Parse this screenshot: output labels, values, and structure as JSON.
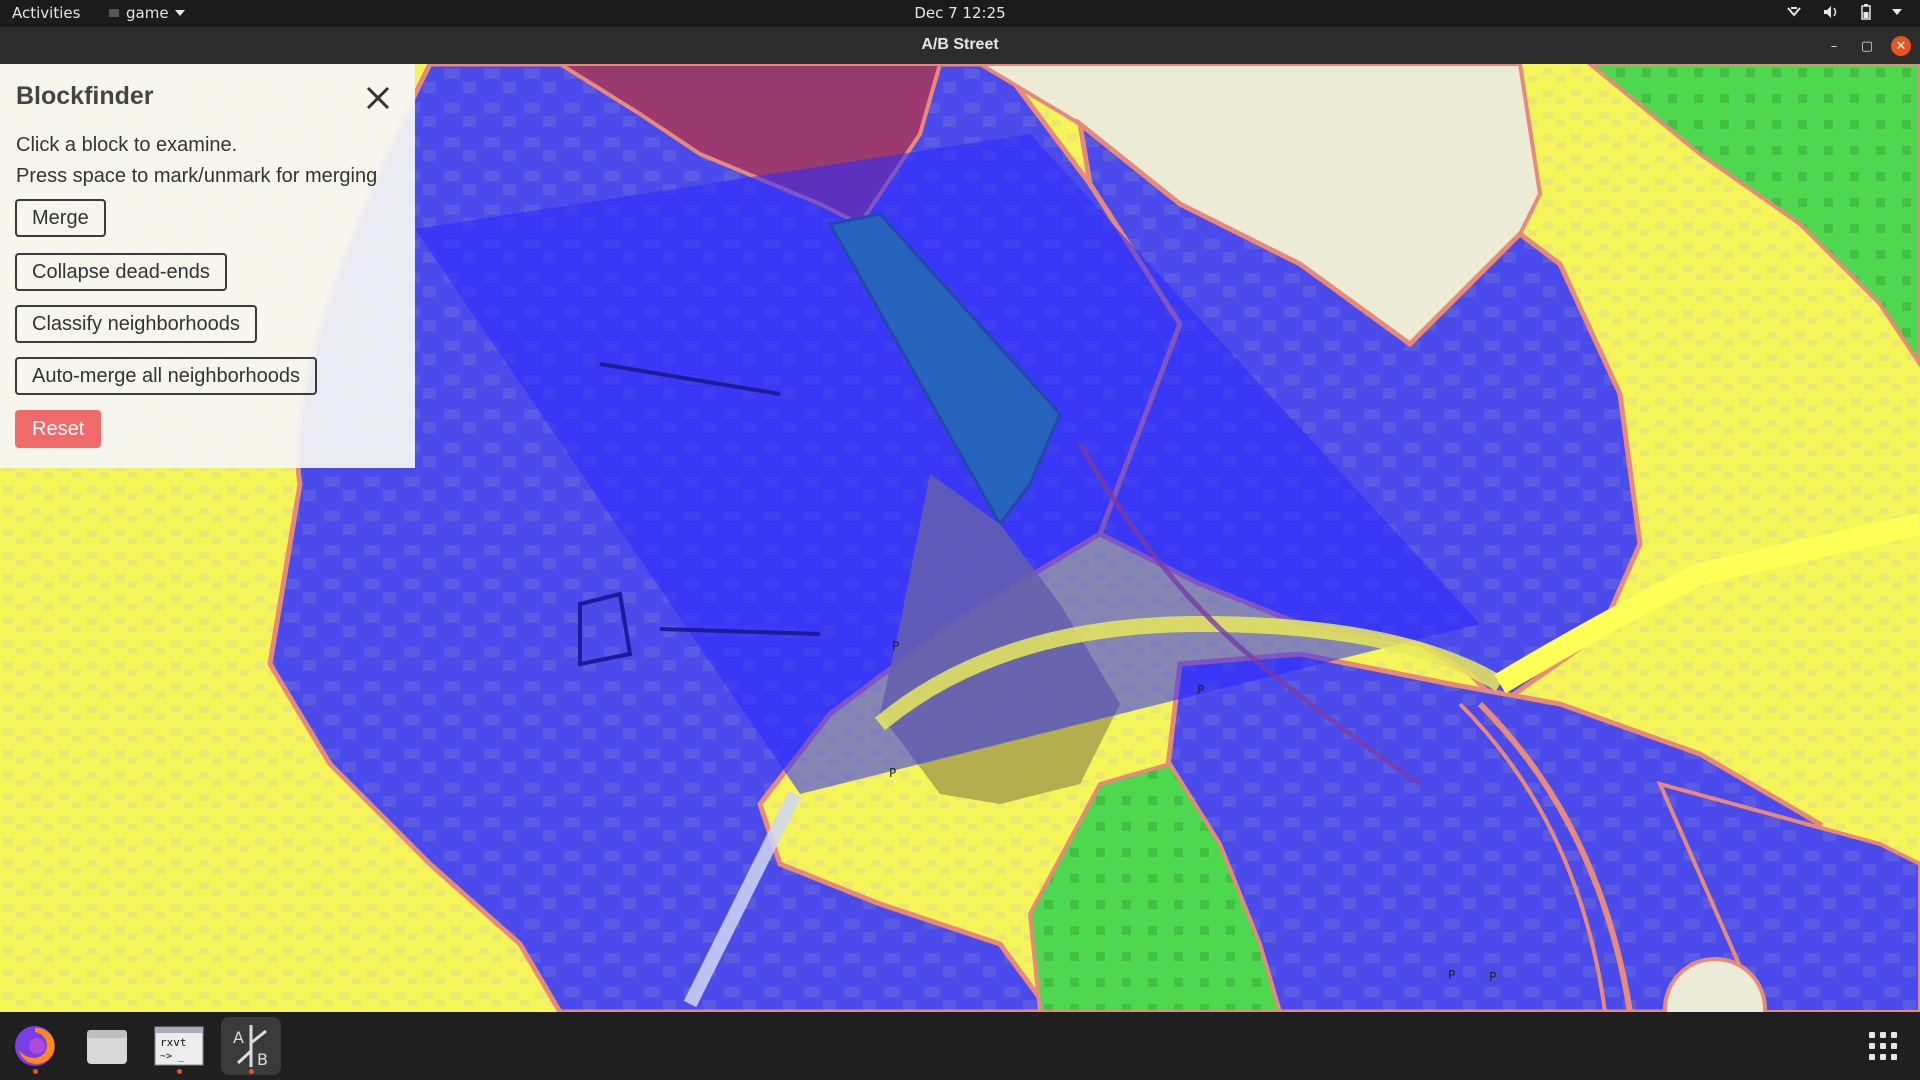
{
  "topbar": {
    "activities": "Activities",
    "app_name": "game",
    "clock": "Dec 7  12:25",
    "tray_icons": [
      "network-icon",
      "volume-icon",
      "battery-icon",
      "system-menu-icon"
    ]
  },
  "window": {
    "title": "A/B Street",
    "controls": [
      "minimize-icon",
      "maximize-icon",
      "close-icon"
    ]
  },
  "panel": {
    "title": "Blockfinder",
    "instruction_1": "Click a block to examine.",
    "instruction_2": "Press space to mark/unmark for merging",
    "buttons": {
      "merge": "Merge",
      "collapse": "Collapse dead-ends",
      "classify": "Classify neighborhoods",
      "automerge": "Auto-merge all neighborhoods",
      "reset": "Reset"
    }
  },
  "map": {
    "parking_labels": [
      "P",
      "P",
      "P",
      "P",
      "P"
    ],
    "colors": {
      "blue": "#3f3ff4",
      "yellow": "#ffff55",
      "green": "#4cd84c",
      "teal_green": "#1f9f6a",
      "maroon": "#9b3a6e",
      "olive": "#a8a04a",
      "cream": "#ecebd6",
      "road_edge": "#e88a7a"
    }
  },
  "dock": {
    "apps": [
      {
        "name": "firefox-icon",
        "running": true
      },
      {
        "name": "files-icon",
        "running": false
      },
      {
        "name": "terminal-icon",
        "label": "rxvt",
        "running": true
      },
      {
        "name": "abstreet-icon",
        "label_a": "A",
        "label_b": "B",
        "running": true
      }
    ],
    "show_apps": "show-apps-icon"
  }
}
